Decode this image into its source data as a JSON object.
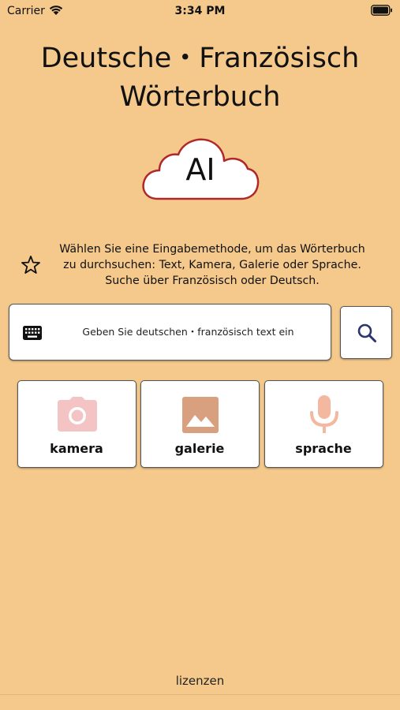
{
  "status_bar": {
    "carrier": "Carrier",
    "time": "3:34 PM"
  },
  "header": {
    "title_line1": "Deutsche・Französisch",
    "title_line2": "Wörterbuch"
  },
  "logo": {
    "text": "AI"
  },
  "instructions": {
    "line1": "Wählen Sie eine Eingabemethode, um das Wörterbuch",
    "line2": "zu durchsuchen: Text, Kamera, Galerie oder Sprache.",
    "line3": "Suche über Französisch oder Deutsch."
  },
  "search": {
    "placeholder": "Geben Sie deutschen・französisch text ein",
    "value": ""
  },
  "input_methods": [
    {
      "label": "kamera",
      "icon": "camera-icon",
      "color": "#f4c4c4"
    },
    {
      "label": "galerie",
      "icon": "image-icon",
      "color": "#d9a080"
    },
    {
      "label": "sprache",
      "icon": "microphone-icon",
      "color": "#f4b8a0"
    }
  ],
  "footer": {
    "licenses_label": "lizenzen"
  },
  "colors": {
    "background": "#f5c98c",
    "logo_outline": "#b02828"
  }
}
